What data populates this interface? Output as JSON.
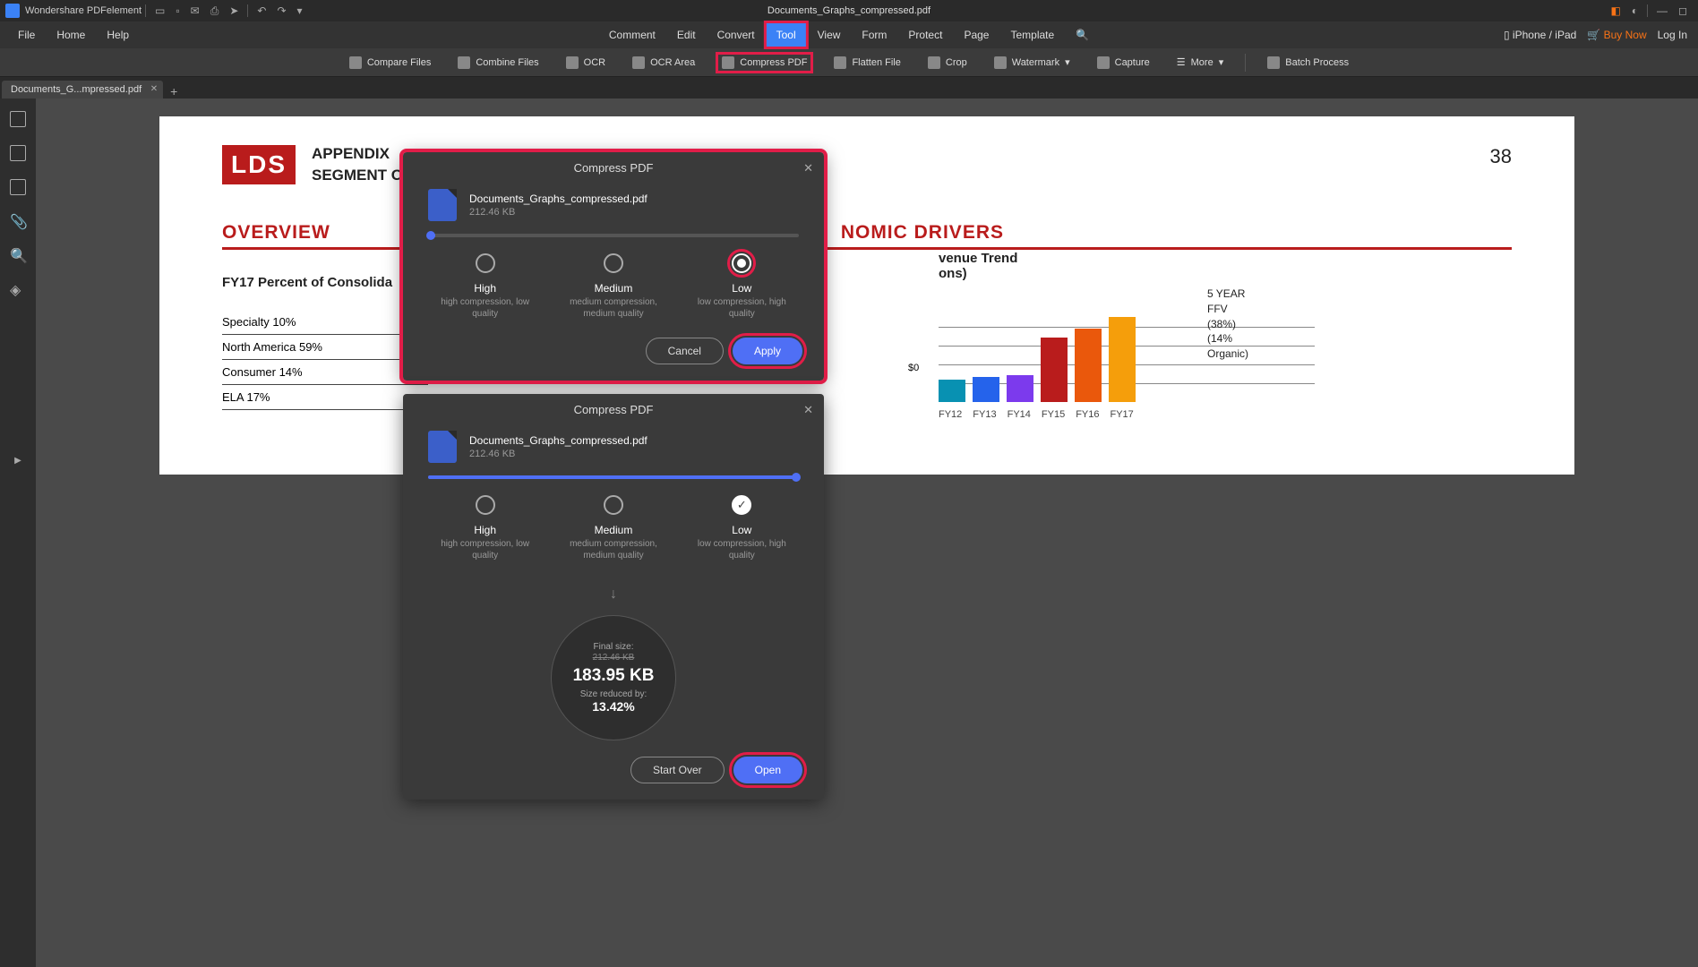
{
  "app": {
    "name": "Wondershare PDFelement",
    "document": "Documents_Graphs_compressed.pdf"
  },
  "titlebar_right": {
    "moon": "◐"
  },
  "menu": {
    "left": [
      "File",
      "Home",
      "Help"
    ],
    "center": [
      "Comment",
      "Edit",
      "Convert",
      "Tool",
      "View",
      "Form",
      "Protect",
      "Page",
      "Template"
    ],
    "active": "Tool",
    "right": {
      "device": "iPhone / iPad",
      "buy": "Buy Now",
      "login": "Log In"
    }
  },
  "toolbar": {
    "items": [
      "Compare Files",
      "Combine Files",
      "OCR",
      "OCR Area",
      "Compress PDF",
      "Flatten File",
      "Crop",
      "Watermark",
      "Capture",
      "More",
      "Batch Process"
    ],
    "highlighted": "Compress PDF"
  },
  "tab": {
    "label": "Documents_G...mpressed.pdf"
  },
  "doc": {
    "badge": "LDS",
    "title1": "APPENDIX",
    "title2": "SEGMENT OVERVI",
    "pagenum": "38",
    "section1": "OVERVIEW",
    "section2": "NOMIC DRIVERS",
    "sub1": "FY17 Percent of Consolida",
    "rows": [
      "Specialty 10%",
      "North America 59%",
      "Consumer 14%",
      "ELA 17%"
    ],
    "trend1": "venue Trend",
    "trend2": "ons)",
    "y0": "$0",
    "note1": "5 YEAR FFV",
    "note2": "(38%)",
    "note3": "(14% Organic)"
  },
  "chart_data": {
    "type": "bar",
    "categories": [
      "FY12",
      "FY13",
      "FY14",
      "FY15",
      "FY16",
      "FY17"
    ],
    "values": [
      25,
      28,
      30,
      72,
      82,
      95
    ],
    "colors": [
      "#0891b2",
      "#2563eb",
      "#7c3aed",
      "#b91c1c",
      "#ea580c",
      "#f59e0b"
    ],
    "ylim": [
      0,
      100
    ]
  },
  "dialog1": {
    "title": "Compress PDF",
    "filename": "Documents_Graphs_compressed.pdf",
    "filesize": "212.46 KB",
    "progress": 2,
    "opts": [
      {
        "name": "High",
        "desc": "high compression,\nlow quality"
      },
      {
        "name": "Medium",
        "desc": "medium compression,\nmedium quality"
      },
      {
        "name": "Low",
        "desc": "low compression,\nhigh quality"
      }
    ],
    "selected": 2,
    "cancel": "Cancel",
    "apply": "Apply"
  },
  "dialog2": {
    "title": "Compress PDF",
    "filename": "Documents_Graphs_compressed.pdf",
    "filesize": "212.46 KB",
    "progress": 100,
    "opts": [
      {
        "name": "High",
        "desc": "high compression,\nlow quality"
      },
      {
        "name": "Medium",
        "desc": "medium compression,\nmedium quality"
      },
      {
        "name": "Low",
        "desc": "low compression,\nhigh quality"
      }
    ],
    "checked": 2,
    "result": {
      "label1": "Final size:",
      "oldsize": "212.46 KB",
      "newsize": "183.95 KB",
      "label2": "Size reduced by:",
      "percent": "13.42%"
    },
    "startover": "Start Over",
    "open": "Open"
  }
}
